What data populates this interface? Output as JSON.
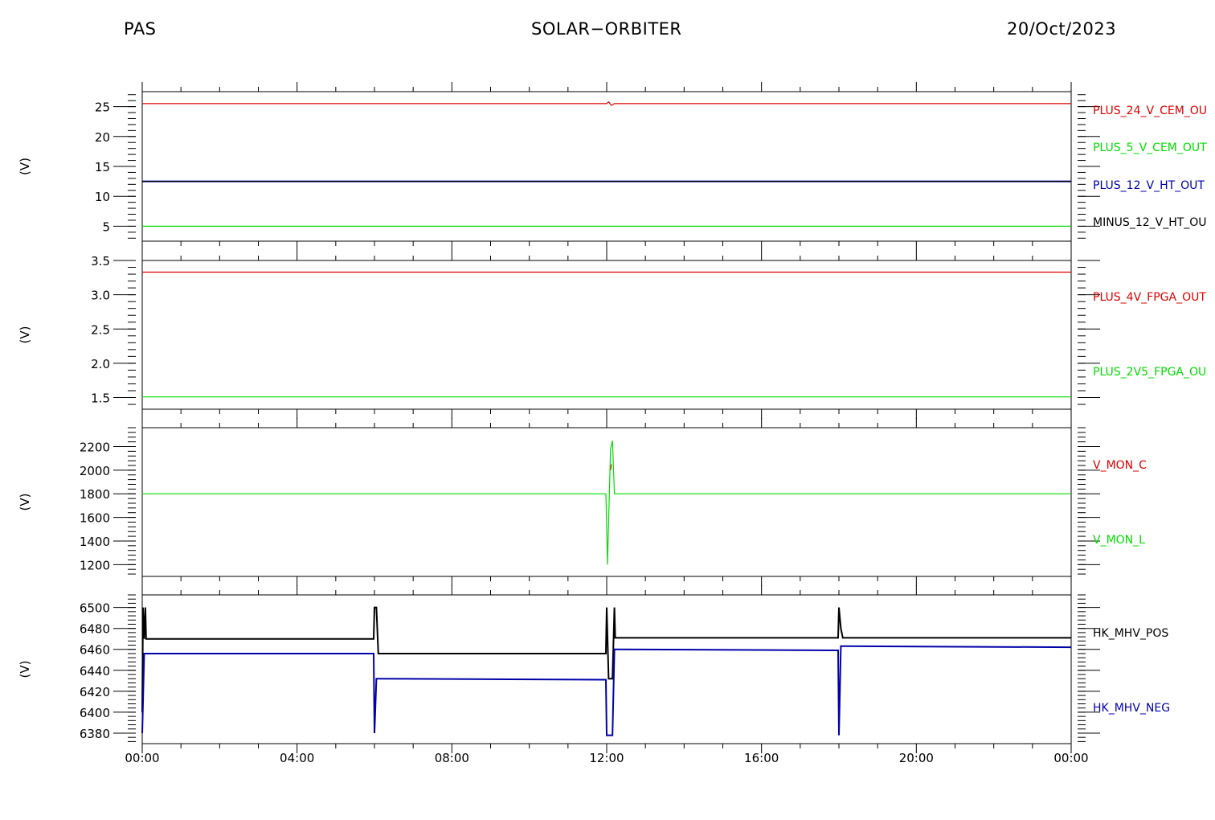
{
  "header": {
    "left": "PAS",
    "center": "SOLAR−ORBITER",
    "right": "20/Oct/2023"
  },
  "colors": {
    "red": "#dd0000",
    "green": "#00dd00",
    "blue": "#0000aa",
    "black": "#000000"
  },
  "chart_data": [
    {
      "type": "line",
      "ylabel": "(V)",
      "ylim": [
        2.5,
        27.5
      ],
      "yticks": [
        5,
        10,
        15,
        20,
        25
      ],
      "ytick_labels": [
        "5",
        "10",
        "15",
        "20",
        "25"
      ],
      "xlim": [
        0,
        24
      ],
      "xticks": [
        0,
        4,
        8,
        12,
        16,
        20,
        24
      ],
      "xtick_labels": [],
      "series": [
        {
          "name": "PLUS_24_V_CEM_OU",
          "color": "#dd0000",
          "x": [
            0,
            12.0,
            12.05,
            12.12,
            12.2,
            24
          ],
          "y": [
            25.5,
            25.5,
            25.8,
            25.2,
            25.5,
            25.5
          ]
        },
        {
          "name": "PLUS_5_V_CEM_OUT",
          "color": "#00dd00",
          "x": [
            0,
            24
          ],
          "y": [
            5.0,
            5.0
          ]
        },
        {
          "name": "PLUS_12_V_HT_OUT",
          "color": "#0000aa",
          "x": [
            0,
            24
          ],
          "y": [
            12.5,
            12.5
          ]
        },
        {
          "name": "MINUS_12_V_HT_OU",
          "color": "#000000",
          "x": [
            0,
            24
          ],
          "y": [
            12.5,
            12.5
          ]
        }
      ]
    },
    {
      "type": "line",
      "ylabel": "(V)",
      "ylim": [
        1.33,
        3.5
      ],
      "yticks": [
        1.5,
        2.0,
        2.5,
        3.0,
        3.5
      ],
      "ytick_labels": [
        "1.5",
        "2.0",
        "2.5",
        "3.0",
        "3.5"
      ],
      "xlim": [
        0,
        24
      ],
      "xticks": [
        0,
        4,
        8,
        12,
        16,
        20,
        24
      ],
      "xtick_labels": [],
      "series": [
        {
          "name": "PLUS_4V_FPGA_OUT",
          "color": "#dd0000",
          "x": [
            0,
            24
          ],
          "y": [
            3.33,
            3.33
          ]
        },
        {
          "name": "PLUS_2V5_FPGA_OU",
          "color": "#00dd00",
          "x": [
            0,
            24
          ],
          "y": [
            1.51,
            1.51
          ]
        }
      ]
    },
    {
      "type": "line",
      "ylabel": "(V)",
      "ylim": [
        1100,
        2360
      ],
      "yticks": [
        1200,
        1400,
        1600,
        1800,
        2000,
        2200
      ],
      "ytick_labels": [
        "1200",
        "1400",
        "1600",
        "1800",
        "2000",
        "2200"
      ],
      "xlim": [
        0,
        24
      ],
      "xticks": [
        0,
        4,
        8,
        12,
        16,
        20,
        24
      ],
      "xtick_labels": [],
      "series": [
        {
          "name": "V_MON_C",
          "color": "#dd0000",
          "x": [
            12.1,
            12.12
          ],
          "y": [
            2000,
            2050
          ]
        },
        {
          "name": "V_MON_L",
          "color": "#00dd00",
          "x": [
            0,
            11.98,
            12.02,
            12.06,
            12.1,
            12.15,
            12.2,
            24
          ],
          "y": [
            1800,
            1800,
            1200,
            1700,
            2180,
            2250,
            1800,
            1800
          ]
        }
      ]
    },
    {
      "type": "line",
      "ylabel": "(V)",
      "ylim": [
        6370,
        6512
      ],
      "yticks": [
        6380,
        6400,
        6420,
        6440,
        6460,
        6480,
        6500
      ],
      "ytick_labels": [
        "6380",
        "6400",
        "6420",
        "6440",
        "6460",
        "6480",
        "6500"
      ],
      "xlim": [
        0,
        24
      ],
      "xticks": [
        0,
        4,
        8,
        12,
        16,
        20,
        24
      ],
      "xtick_labels": [
        "00:00",
        "04:00",
        "08:00",
        "12:00",
        "16:00",
        "20:00",
        "00:00"
      ],
      "series": [
        {
          "name": "HK_MHV_POS",
          "color": "#000000",
          "x": [
            0,
            0.02,
            0.05,
            0.08,
            0.1,
            5.98,
            6.0,
            6.05,
            6.1,
            11.98,
            12.0,
            12.05,
            12.15,
            12.2,
            12.22,
            17.98,
            18.0,
            18.05,
            18.1,
            24
          ],
          "y": [
            6400,
            6500,
            6470,
            6500,
            6470,
            6470,
            6500,
            6500,
            6456,
            6456,
            6500,
            6432,
            6432,
            6500,
            6471,
            6471,
            6500,
            6480,
            6471,
            6471
          ]
        },
        {
          "name": "HK_MHV_NEG",
          "color": "#0000aa",
          "x": [
            0,
            0.02,
            0.05,
            0.1,
            5.98,
            6.0,
            6.05,
            6.1,
            11.98,
            12.0,
            12.05,
            12.15,
            12.2,
            12.22,
            17.98,
            18.0,
            18.05,
            18.1,
            24
          ],
          "y": [
            6380,
            6410,
            6456,
            6456,
            6456,
            6380,
            6432,
            6432,
            6431,
            6378,
            6378,
            6378,
            6460,
            6460,
            6459,
            6378,
            6463,
            6463,
            6462
          ]
        }
      ]
    }
  ]
}
